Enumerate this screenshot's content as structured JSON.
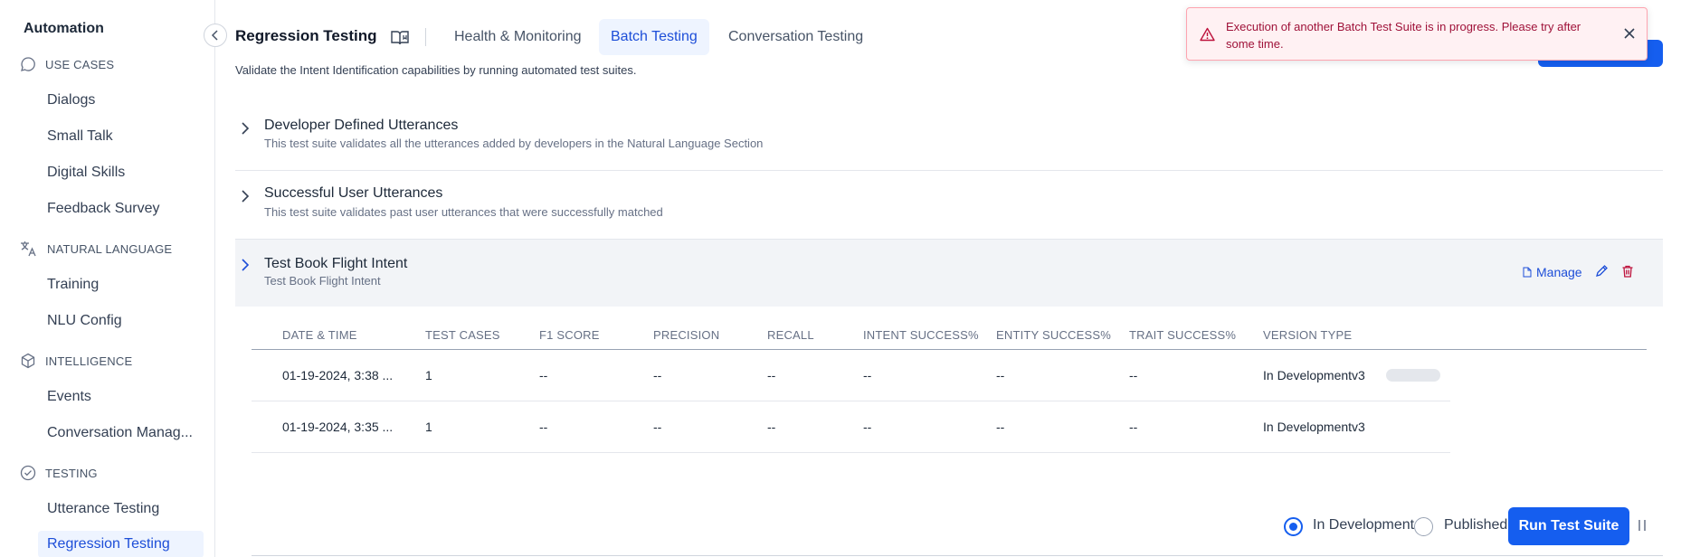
{
  "sidebar": {
    "title": "Automation",
    "sections": [
      {
        "label": "USE CASES",
        "icon": "chat-bubble-icon",
        "items": [
          "Dialogs",
          "Small Talk",
          "Digital Skills",
          "Feedback Survey"
        ]
      },
      {
        "label": "NATURAL LANGUAGE",
        "icon": "translate-icon",
        "items": [
          "Training",
          "NLU Config"
        ]
      },
      {
        "label": "INTELLIGENCE",
        "icon": "cube-icon",
        "items": [
          "Events",
          "Conversation Manag..."
        ]
      },
      {
        "label": "TESTING",
        "icon": "check-circle-icon",
        "items": [
          "Utterance Testing",
          "Regression Testing"
        ]
      }
    ],
    "active_item": "Regression Testing"
  },
  "header": {
    "title": "Regression Testing",
    "tabs": [
      {
        "label": "Health & Monitoring",
        "active": false
      },
      {
        "label": "Batch Testing",
        "active": true
      },
      {
        "label": "Conversation Testing",
        "active": false
      }
    ],
    "subtitle": "Validate the Intent Identification capabilities by running automated test suites."
  },
  "toast": {
    "message": "Execution of another Batch Test Suite is in progress. Please try after some time.",
    "type": "error"
  },
  "suites": [
    {
      "name": "Developer Defined Utterances",
      "description": "This test suite validates all the utterances added by developers in the Natural Language Section",
      "expanded": false
    },
    {
      "name": "Successful User Utterances",
      "description": "This test suite validates past user utterances that were successfully matched",
      "expanded": false
    },
    {
      "name": "Test Book Flight Intent",
      "description": "Test Book Flight Intent",
      "expanded": true
    }
  ],
  "suite_actions": {
    "manage_label": "Manage"
  },
  "table": {
    "columns": [
      "DATE & TIME",
      "TEST CASES",
      "F1 SCORE",
      "PRECISION",
      "RECALL",
      "INTENT SUCCESS%",
      "ENTITY SUCCESS%",
      "TRAIT SUCCESS%",
      "VERSION TYPE"
    ],
    "rows": [
      [
        "01-19-2024, 3:38 ...",
        "1",
        "--",
        "--",
        "--",
        "--",
        "--",
        "--",
        "In Developmentv3"
      ],
      [
        "01-19-2024, 3:35 ...",
        "1",
        "--",
        "--",
        "--",
        "--",
        "--",
        "--",
        "In Developmentv3"
      ]
    ]
  },
  "footer": {
    "options": [
      {
        "label": "In Development",
        "checked": true
      },
      {
        "label": "Published",
        "checked": false
      }
    ],
    "run_label": "Run Test Suite"
  },
  "colors": {
    "accent": "#155eef",
    "error_bg": "#fff1f3",
    "error_text": "#9f1239"
  }
}
